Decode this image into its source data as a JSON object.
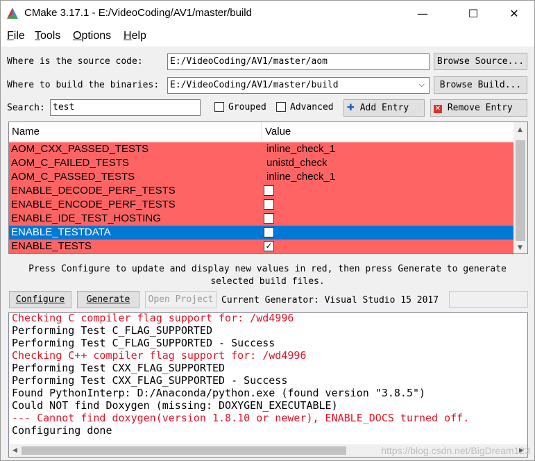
{
  "window": {
    "title": "CMake 3.17.1 - E:/VideoCoding/AV1/master/build",
    "minimize_glyph": "—",
    "maximize_glyph": "☐",
    "close_glyph": "✕"
  },
  "menu": {
    "items": [
      {
        "key": "F",
        "rest": "ile"
      },
      {
        "key": "T",
        "rest": "ools"
      },
      {
        "key": "O",
        "rest": "ptions"
      },
      {
        "key": "H",
        "rest": "elp"
      }
    ]
  },
  "source": {
    "label": "Where is the source code:",
    "value": "E:/VideoCoding/AV1/master/aom",
    "browse_label": "Browse Source..."
  },
  "build": {
    "label": "Where to build the binaries:",
    "value": "E:/VideoCoding/AV1/master/build",
    "browse_label": "Browse Build..."
  },
  "search": {
    "label": "Search:",
    "value": "test",
    "grouped_label": "Grouped",
    "grouped_checked": false,
    "advanced_label": "Advanced",
    "advanced_checked": false,
    "add_entry_label": "Add Entry",
    "remove_entry_label": "Remove Entry"
  },
  "table": {
    "columns": [
      "Name",
      "Value"
    ],
    "rows": [
      {
        "name": "AOM_CXX_PASSED_TESTS",
        "value": "inline_check_1",
        "kind": "text",
        "selected": false
      },
      {
        "name": "AOM_C_FAILED_TESTS",
        "value": "unistd_check",
        "kind": "text",
        "selected": false
      },
      {
        "name": "AOM_C_PASSED_TESTS",
        "value": "inline_check_1",
        "kind": "text",
        "selected": false
      },
      {
        "name": "ENABLE_DECODE_PERF_TESTS",
        "value": "",
        "kind": "bool",
        "checked": false,
        "selected": false
      },
      {
        "name": "ENABLE_ENCODE_PERF_TESTS",
        "value": "",
        "kind": "bool",
        "checked": false,
        "selected": false
      },
      {
        "name": "ENABLE_IDE_TEST_HOSTING",
        "value": "",
        "kind": "bool",
        "checked": false,
        "selected": false
      },
      {
        "name": "ENABLE_TESTDATA",
        "value": "",
        "kind": "bool",
        "checked": false,
        "selected": true
      },
      {
        "name": "ENABLE_TESTS",
        "value": "",
        "kind": "bool",
        "checked": true,
        "selected": false
      }
    ]
  },
  "hint": {
    "line1": "Press Configure to update and display new values in red, then press Generate to generate",
    "line2": "selected build files."
  },
  "actions": {
    "configure_label": "Configure",
    "generate_label": "Generate",
    "open_project_label": "Open Project",
    "generator_text": "Current Generator: Visual Studio 15 2017"
  },
  "output": {
    "lines": [
      {
        "text": "Checking C compiler flag support for: /wd4996",
        "error": true
      },
      {
        "text": "Performing Test C_FLAG_SUPPORTED",
        "error": false
      },
      {
        "text": "Performing Test C_FLAG_SUPPORTED - Success",
        "error": false
      },
      {
        "text": "Checking C++ compiler flag support for: /wd4996",
        "error": true
      },
      {
        "text": "Performing Test CXX_FLAG_SUPPORTED",
        "error": false
      },
      {
        "text": "Performing Test CXX_FLAG_SUPPORTED - Success",
        "error": false
      },
      {
        "text": "Found PythonInterp: D:/Anaconda/python.exe (found version \"3.8.5\")",
        "error": false
      },
      {
        "text": "Could NOT find Doxygen (missing: DOXYGEN_EXECUTABLE)",
        "error": false
      },
      {
        "text": "--- Cannot find doxygen(version 1.8.10 or newer), ENABLE_DOCS turned off.",
        "error": true
      },
      {
        "text": "Configuring done",
        "error": false
      }
    ]
  },
  "watermark": "https://blog.csdn.net/BigDream123",
  "colors": {
    "changed_row": "#ff6464",
    "selected_row": "#0078d7",
    "error_text": "#e81123"
  }
}
